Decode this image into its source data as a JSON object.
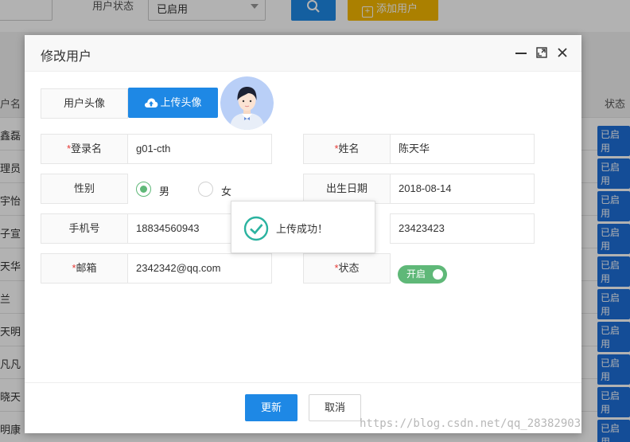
{
  "background": {
    "filter": {
      "status_label": "用户状态",
      "status_value": "已启用",
      "add_user_label": "添加用户"
    },
    "table": {
      "name_header": "户名",
      "status_header": "状态",
      "rows": [
        {
          "name": "鑫磊",
          "status": "已启用"
        },
        {
          "name": "理员",
          "status": "已启用"
        },
        {
          "name": "宇怡",
          "status": "已启用"
        },
        {
          "name": "子宣",
          "status": "已启用"
        },
        {
          "name": "天华",
          "status": "已启用"
        },
        {
          "name": "兰",
          "status": "已启用"
        },
        {
          "name": "天明",
          "status": "已启用"
        },
        {
          "name": "凡凡",
          "status": "已启用"
        },
        {
          "name": "晓天",
          "status": "已启用"
        },
        {
          "name": "明康",
          "status": "已启用"
        }
      ]
    }
  },
  "dialog": {
    "title": "修改用户",
    "avatar_label": "用户头像",
    "upload_label": "上传头像",
    "fields": {
      "login_name": {
        "label": "登录名",
        "value": "g01-cth"
      },
      "real_name": {
        "label": "姓名",
        "value": "陈天华"
      },
      "gender": {
        "label": "性别",
        "male": "男",
        "female": "女",
        "selected": "男"
      },
      "birth_date": {
        "label": "出生日期",
        "value": "2018-08-14"
      },
      "phone": {
        "label": "手机号",
        "value": "18834560943"
      },
      "hidden_field_value": "23423423",
      "email": {
        "label": "邮箱",
        "value": "2342342@qq.com"
      },
      "status": {
        "label": "状态",
        "value": "开启"
      }
    },
    "buttons": {
      "update": "更新",
      "cancel": "取消"
    }
  },
  "toast": {
    "message": "上传成功！"
  },
  "watermark": "https://blog.csdn.net/qq_28382903",
  "colors": {
    "primary": "#1e88e5",
    "success": "#5fb878",
    "warning": "#f5b800",
    "required": "#e53935"
  }
}
